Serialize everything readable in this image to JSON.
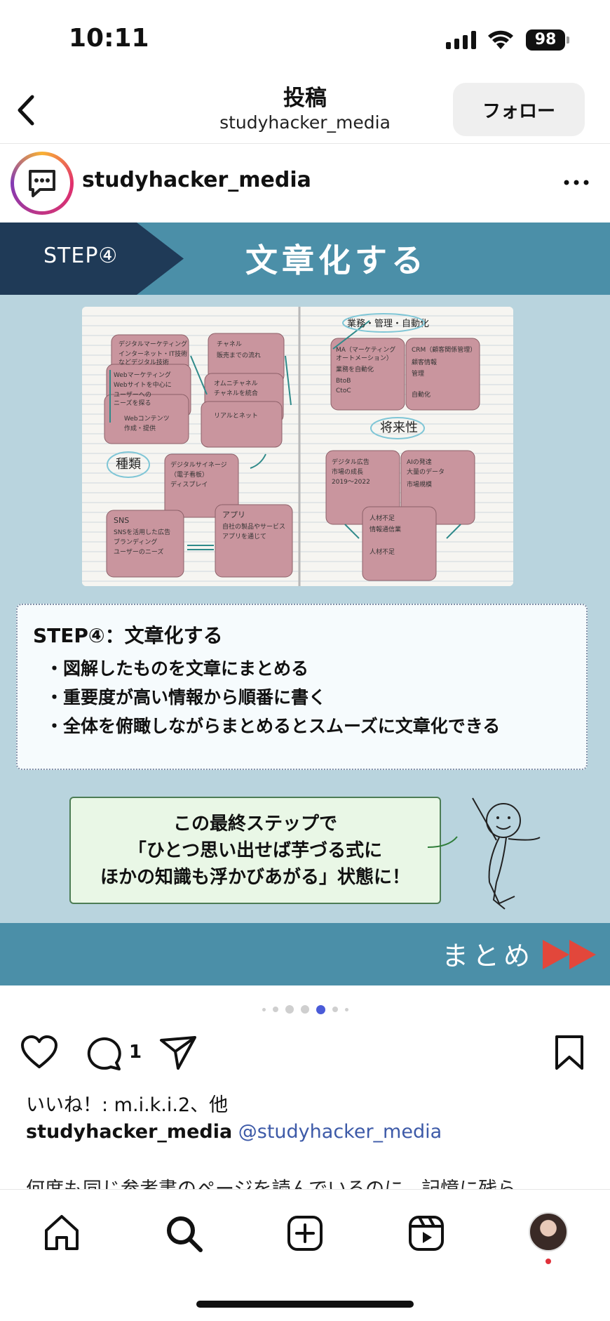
{
  "status_bar": {
    "time": "10:11",
    "battery": "98"
  },
  "nav": {
    "title": "投稿",
    "subtitle": "studyhacker_media",
    "follow_label": "フォロー"
  },
  "post": {
    "username": "studyhacker_media"
  },
  "slide": {
    "step_label": "STEP④",
    "step_title": "文章化する",
    "box_title": "STEP④：文章化する",
    "bullets": [
      "・図解したものを文章にまとめる",
      "・重要度が高い情報から順番に書く",
      "・全体を俯瞰しながらまとめるとスムーズに文章化できる"
    ],
    "callout_lines": [
      "この最終ステップで",
      "「ひとつ思い出せば芋づる式に",
      "ほかの知識も浮かびあがる」状態に！"
    ],
    "summary": "まとめ",
    "notebook_cards": {
      "top_left": [
        "デジタルマーケティング",
        "インターネット・IT技術",
        "などデジタル技術",
        "Webマーケティング",
        "Webサイトを中心に",
        "ユーザーへの",
        "ニーズを探る",
        "Webコンテンツ",
        "作成・提供"
      ],
      "top_mid": [
        "チャネル",
        "販売までの流れ",
        "オムニチャネル",
        "チャネルを統合",
        "リアルとネット"
      ],
      "mid_left_label": "種類",
      "mid_center": [
        "デジタルサイネージ",
        "（電子看板）",
        "ディスプレイ"
      ],
      "bottom_left": [
        "SNS",
        "SNSを活用した広告",
        "ブランディング",
        "ユーザーのニーズ"
      ],
      "bottom_mid": [
        "アプリ",
        "自社の製品やサービス",
        "アプリを通じて"
      ],
      "right_header": "業務・管理・自動化",
      "right_top_left": [
        "MA（マーケティングオートメーション）",
        "業務を自動化",
        "BtoB",
        "CtoC"
      ],
      "right_top_right": [
        "CRM（顧客関係管理）",
        "顧客情報",
        "管理",
        "自動化"
      ],
      "right_mid_label": "将来性",
      "right_bottom_left": [
        "デジタル広告",
        "市場の成長",
        "2019〜2022"
      ],
      "right_bottom_right": [
        "AIの発達",
        "大量のデータ",
        "市場規模"
      ],
      "right_bottom_center": [
        "人材不足",
        "情報通信業",
        "人材不足"
      ]
    }
  },
  "carousel": {
    "total": 7,
    "active": 4
  },
  "actions": {
    "comment_count": "1"
  },
  "likes_text": "いいね！: m.i.k.i.2、他",
  "caption": {
    "username": "studyhacker_media",
    "mention": "@studyhacker_media",
    "more": "何度も同じ参考書のページを読んでいるのに、記憶に残ら"
  },
  "colors": {
    "slide_bg": "#b9d4de",
    "band": "#4b8fa8",
    "chevron": "#1f3a57",
    "card": "#c9959e",
    "mention": "#3d5aa8",
    "summary_arrows": "#e2473b"
  },
  "icons": {
    "heart": "heart-icon",
    "comment": "comment-icon",
    "share": "send-icon",
    "bookmark": "bookmark-icon"
  }
}
